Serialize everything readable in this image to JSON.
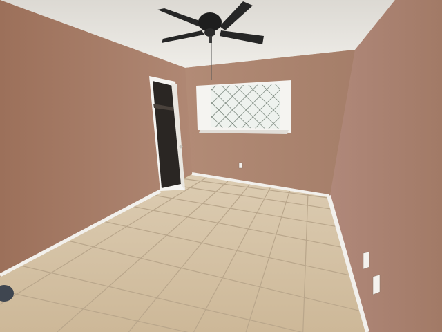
{
  "scene": {
    "ceiling_color": "#e8e6e1",
    "wall_color": "#ad8570",
    "left_wall_color": "#a87d66",
    "right_wall_color": "#a98470",
    "floor_color": "#d9c7ab",
    "grout_color": "#b9a68b",
    "baseboard_color": "#f2f0ec",
    "trim_color": "#f5f4f1",
    "fan_color": "#262626",
    "window_glass_color": "#eef2ee",
    "closet_interior_color": "#2a2623"
  }
}
